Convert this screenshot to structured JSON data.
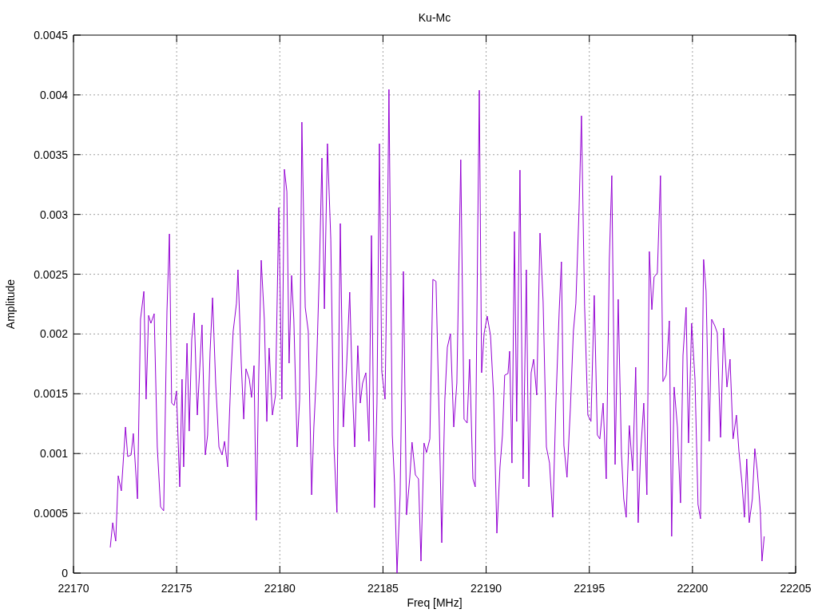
{
  "chart": {
    "chart_data": {
      "type": "line",
      "title": "Ku-Mc",
      "xlabel": "Freq [MHz]",
      "ylabel": "Amplitude",
      "xlim": [
        22170,
        22205
      ],
      "grid": true,
      "ylim": [
        0,
        0.0045
      ],
      "xticks": [
        22170,
        22175,
        22180,
        22185,
        22190,
        22195,
        22200,
        22205
      ],
      "yticks": [
        0,
        0.0005,
        0.001,
        0.0015,
        0.002,
        0.0025,
        0.003,
        0.0035,
        0.004,
        0.0045
      ],
      "x": [
        22171.78,
        22171.9,
        22172.05,
        22172.17,
        22172.32,
        22172.52,
        22172.63,
        22172.79,
        22172.9,
        22173.1,
        22173.25,
        22173.41,
        22173.52,
        22173.64,
        22173.75,
        22173.91,
        22174.06,
        22174.22,
        22174.37,
        22174.53,
        22174.65,
        22174.76,
        22174.88,
        22174.99,
        22175.15,
        22175.26,
        22175.34,
        22175.5,
        22175.61,
        22175.73,
        22175.85,
        22176.0,
        22176.12,
        22176.23,
        22176.39,
        22176.5,
        22176.62,
        22176.74,
        22176.89,
        22177.05,
        22177.2,
        22177.32,
        22177.47,
        22177.63,
        22177.74,
        22177.9,
        22177.97,
        22178.13,
        22178.25,
        22178.36,
        22178.52,
        22178.63,
        22178.75,
        22178.86,
        22178.98,
        22179.1,
        22179.25,
        22179.37,
        22179.48,
        22179.64,
        22179.79,
        22179.95,
        22180.1,
        22180.22,
        22180.34,
        22180.45,
        22180.57,
        22180.68,
        22180.84,
        22180.96,
        22181.07,
        22181.23,
        22181.38,
        22181.54,
        22181.65,
        22181.77,
        22181.92,
        22182.04,
        22182.16,
        22182.31,
        22182.47,
        22182.62,
        22182.77,
        22182.93,
        22183.08,
        22183.24,
        22183.39,
        22183.51,
        22183.63,
        22183.78,
        22183.9,
        22184.01,
        22184.17,
        22184.32,
        22184.44,
        22184.59,
        22184.71,
        22184.83,
        22184.94,
        22185.1,
        22185.21,
        22185.29,
        22185.45,
        22185.56,
        22185.68,
        22185.83,
        22185.99,
        22186.14,
        22186.3,
        22186.41,
        22186.57,
        22186.72,
        22186.84,
        22186.99,
        22187.11,
        22187.27,
        22187.42,
        22187.57,
        22187.73,
        22187.85,
        22188.0,
        22188.12,
        22188.27,
        22188.43,
        22188.58,
        22188.77,
        22188.93,
        22189.08,
        22189.2,
        22189.36,
        22189.47,
        22189.59,
        22189.67,
        22189.78,
        22189.9,
        22190.05,
        22190.21,
        22190.36,
        22190.52,
        22190.67,
        22190.79,
        22190.9,
        22191.06,
        22191.14,
        22191.25,
        22191.37,
        22191.48,
        22191.64,
        22191.79,
        22191.95,
        22192.07,
        22192.18,
        22192.3,
        22192.45,
        22192.61,
        22192.76,
        22192.92,
        22193.07,
        22193.23,
        22193.38,
        22193.54,
        22193.65,
        22193.77,
        22193.92,
        22194.08,
        22194.23,
        22194.35,
        22194.5,
        22194.62,
        22194.77,
        22194.93,
        22195.08,
        22195.24,
        22195.39,
        22195.51,
        22195.67,
        22195.82,
        22195.97,
        22196.09,
        22196.25,
        22196.4,
        22196.56,
        22196.67,
        22196.79,
        22196.94,
        22197.1,
        22197.25,
        22197.37,
        22197.48,
        22197.64,
        22197.79,
        22197.91,
        22198.03,
        22198.14,
        22198.3,
        22198.45,
        22198.57,
        22198.72,
        22198.88,
        22198.99,
        22199.11,
        22199.27,
        22199.42,
        22199.54,
        22199.69,
        22199.81,
        22199.96,
        22200.12,
        22200.27,
        22200.39,
        22200.54,
        22200.66,
        22200.81,
        22200.93,
        22201.08,
        22201.2,
        22201.36,
        22201.51,
        22201.67,
        22201.82,
        22201.97,
        22202.13,
        22202.25,
        22202.4,
        22202.52,
        22202.63,
        22202.75,
        22202.9,
        22203.02,
        22203.14,
        22203.29,
        22203.37,
        22203.48
      ],
      "series": [
        {
          "color": "#9400d3",
          "values": [
            0.000214,
            0.000421,
            0.000267,
            0.000814,
            0.000688,
            0.001222,
            0.000975,
            0.000988,
            0.001168,
            0.000621,
            0.002123,
            0.002357,
            0.001455,
            0.002156,
            0.00209,
            0.00217,
            0.001055,
            0.000554,
            0.000521,
            0.00219,
            0.002837,
            0.001422,
            0.001402,
            0.001522,
            0.000721,
            0.001622,
            0.000888,
            0.001923,
            0.001188,
            0.001956,
            0.002176,
            0.001322,
            0.001722,
            0.002076,
            0.000988,
            0.001155,
            0.001856,
            0.002303,
            0.001589,
            0.001055,
            0.000988,
            0.001102,
            0.000888,
            0.001656,
            0.002023,
            0.002256,
            0.002537,
            0.001756,
            0.001288,
            0.001709,
            0.001622,
            0.001469,
            0.001736,
            0.000441,
            0.001656,
            0.002617,
            0.002123,
            0.001268,
            0.001883,
            0.001322,
            0.001489,
            0.003058,
            0.001455,
            0.003378,
            0.003191,
            0.001756,
            0.00249,
            0.002123,
            0.001055,
            0.001455,
            0.003772,
            0.002223,
            0.002023,
            0.000654,
            0.001222,
            0.001656,
            0.002557,
            0.003472,
            0.00221,
            0.003592,
            0.00279,
            0.001068,
            0.000507,
            0.002924,
            0.001222,
            0.001756,
            0.00235,
            0.001589,
            0.001055,
            0.001903,
            0.001422,
            0.001589,
            0.001676,
            0.001102,
            0.002824,
            0.000547,
            0.001422,
            0.003592,
            0.001689,
            0.001455,
            0.002757,
            0.004046,
            0.001155,
            0.000754,
            0,
            0.000654,
            0.002524,
            0.000487,
            0.000801,
            0.001095,
            0.000821,
            0.000788,
            0.0001,
            0.001088,
            0.001008,
            0.001122,
            0.002457,
            0.00244,
            0.001255,
            0.000254,
            0.001455,
            0.001889,
            0.002003,
            0.001222,
            0.001589,
            0.003458,
            0.001288,
            0.001255,
            0.001789,
            0.000788,
            0.000721,
            0.002824,
            0.004039,
            0.001676,
            0.002003,
            0.00215,
            0.001989,
            0.001489,
            0.000334,
            0.000888,
            0.001155,
            0.001656,
            0.001669,
            0.001856,
            0.000921,
            0.002857,
            0.001268,
            0.003371,
            0.000788,
            0.002537,
            0.000721,
            0.001676,
            0.001789,
            0.001489,
            0.002844,
            0.00227,
            0.001055,
            0.000921,
            0.000467,
            0.001422,
            0.00219,
            0.002604,
            0.001068,
            0.000801,
            0.001375,
            0.002023,
            0.002256,
            0.003024,
            0.003825,
            0.002236,
            0.001322,
            0.001268,
            0.002323,
            0.001155,
            0.001122,
            0.001422,
            0.000788,
            0.002624,
            0.003325,
            0.000908,
            0.00229,
            0.000988,
            0.000621,
            0.000467,
            0.001235,
            0.000855,
            0.001722,
            0.000421,
            0.000988,
            0.001422,
            0.000654,
            0.00269,
            0.002203,
            0.002477,
            0.00251,
            0.003325,
            0.001602,
            0.001656,
            0.00211,
            0.000307,
            0.001556,
            0.001222,
            0.000587,
            0.001823,
            0.002223,
            0.001088,
            0.00209,
            0.001622,
            0.000574,
            0.000454,
            0.002624,
            0.002357,
            0.001102,
            0.002123,
            0.00207,
            0.00201,
            0.001135,
            0.00205,
            0.001556,
            0.001789,
            0.001122,
            0.001322,
            0.001021,
            0.000754,
            0.000467,
            0.000955,
            0.000421,
            0.000621,
            0.001041,
            0.000855,
            0.000521,
            0.0001,
            0.000307
          ]
        }
      ]
    }
  }
}
